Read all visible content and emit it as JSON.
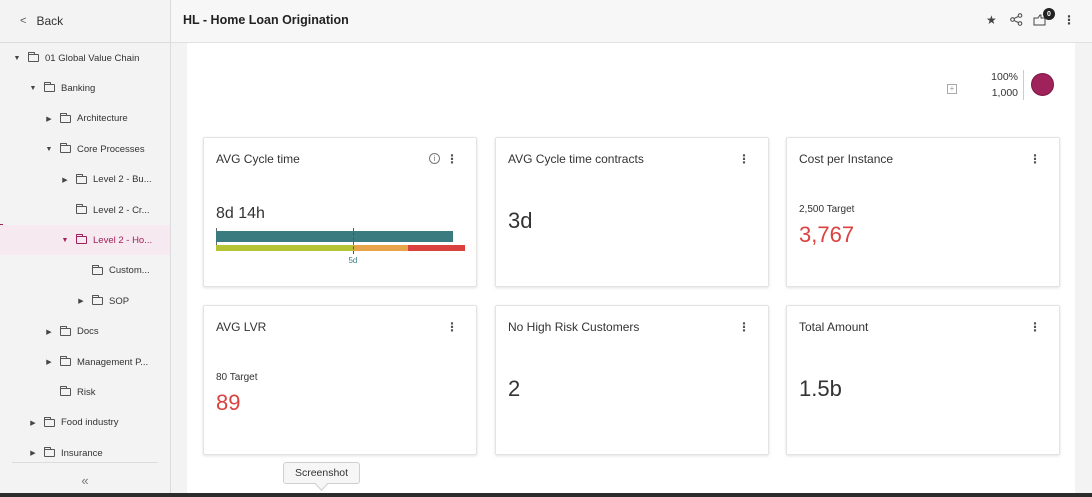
{
  "sidebar": {
    "back_label": "Back",
    "collapse_glyph": "«",
    "tree": [
      {
        "label": "01 Global Value Chain",
        "caret": "▼",
        "depth": 0
      },
      {
        "label": "Banking",
        "caret": "▼",
        "depth": 1
      },
      {
        "label": "Architecture",
        "caret": "▶",
        "depth": 2
      },
      {
        "label": "Core Processes",
        "caret": "▼",
        "depth": 2
      },
      {
        "label": "Level 2 - Bu...",
        "caret": "▶",
        "depth": 3
      },
      {
        "label": "Level 2 - Cr...",
        "caret": "",
        "depth": 3
      },
      {
        "label": "Level 2 - Ho...",
        "caret": "▼",
        "depth": 3,
        "active": true
      },
      {
        "label": "Custom...",
        "caret": "",
        "depth": 4
      },
      {
        "label": "SOP",
        "caret": "▶",
        "depth": 4
      },
      {
        "label": "Docs",
        "caret": "▶",
        "depth": 2
      },
      {
        "label": "Management P...",
        "caret": "▶",
        "depth": 2
      },
      {
        "label": "Risk",
        "caret": "",
        "depth": 2
      },
      {
        "label": "Food industry",
        "caret": "▶",
        "depth": 1
      },
      {
        "label": "Insurance",
        "caret": "▶",
        "depth": 1
      }
    ]
  },
  "header": {
    "title": "HL - Home Loan Origination",
    "notification_count": "0",
    "icons": [
      "star-icon",
      "share-icon",
      "notification-icon",
      "more-vert-icon"
    ]
  },
  "summary": {
    "percent": "100%",
    "count": "1,000",
    "zoom_glyph": "+"
  },
  "cards": {
    "avg_cycle": {
      "title": "AVG Cycle time",
      "value": "8d 14h",
      "marker_label": "5d",
      "bar_fraction": 0.95,
      "marker_fraction": 0.55,
      "bands": [
        {
          "color": "#b5c434",
          "fraction": 0.55
        },
        {
          "color": "#e8a44a",
          "fraction": 0.22
        },
        {
          "color": "#d9423f",
          "fraction": 0.23
        }
      ]
    },
    "avg_cycle_contracts": {
      "title": "AVG Cycle time contracts",
      "value": "3d"
    },
    "cost_per_instance": {
      "title": "Cost per Instance",
      "target": "2,500 Target",
      "value": "3,767"
    },
    "avg_lvr": {
      "title": "AVG LVR",
      "target": "80 Target",
      "value": "89"
    },
    "high_risk": {
      "title": "No High Risk Customers",
      "value": "2"
    },
    "total_amount": {
      "title": "Total Amount",
      "value": "1.5b"
    }
  },
  "tooltip": {
    "label": "Screenshot"
  },
  "colors": {
    "accent": "#a0225a",
    "bar_main": "#3a7b80",
    "alert_red": "#d9423f"
  }
}
